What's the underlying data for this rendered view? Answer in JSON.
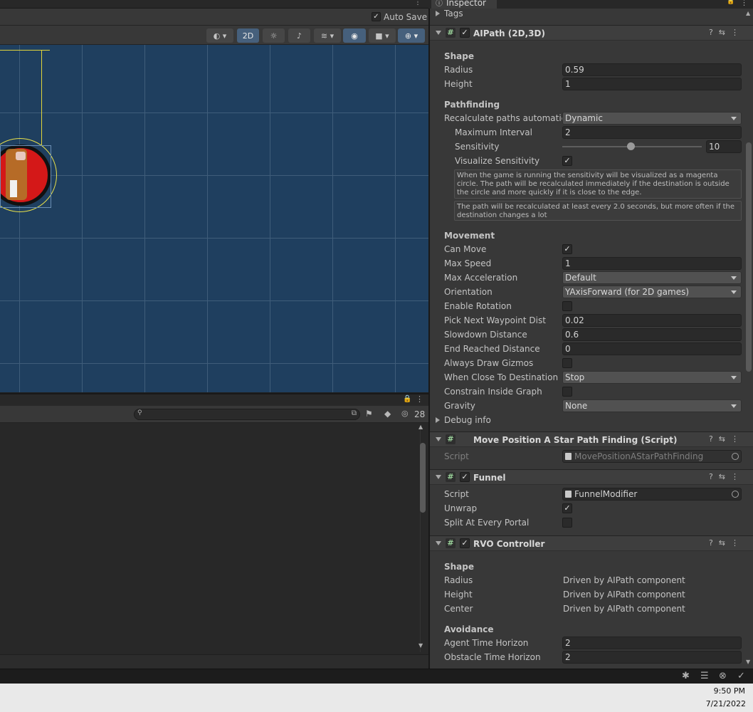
{
  "scene": {
    "auto_save": "Auto Save",
    "mode_2d": "2D"
  },
  "console": {
    "search_placeholder": "",
    "count": "28"
  },
  "inspector": {
    "tab_title": "Inspector",
    "tags_label": "Tags",
    "aipath": {
      "title": "AIPath (2D,3D)",
      "shape_section": "Shape",
      "radius_label": "Radius",
      "radius_value": "0.59",
      "height_label": "Height",
      "height_value": "1",
      "pathfinding_section": "Pathfinding",
      "recalc_label": "Recalculate paths automatica",
      "recalc_value": "Dynamic",
      "maxint_label": "Maximum Interval",
      "maxint_value": "2",
      "sens_label": "Sensitivity",
      "sens_value": "10",
      "sens_fraction": 0.49,
      "vissens_label": "Visualize Sensitivity",
      "vissens_checked": "✓",
      "help1": "When the game is running the sensitivity will be visualized as a magenta circle. The path will be recalculated immediately if the destination is outside the circle and more quickly if it is close to the edge.",
      "help2": "The path will be recalculated at least every 2.0 seconds, but more often if the destination changes a lot",
      "movement_section": "Movement",
      "canmove_label": "Can Move",
      "canmove_checked": "✓",
      "maxspeed_label": "Max Speed",
      "maxspeed_value": "1",
      "maxacc_label": "Max Acceleration",
      "maxacc_value": "Default",
      "orient_label": "Orientation",
      "orient_value": "YAxisForward (for 2D games)",
      "enrot_label": "Enable Rotation",
      "pnwd_label": "Pick Next Waypoint Dist",
      "pnwd_value": "0.02",
      "slow_label": "Slowdown Distance",
      "slow_value": "0.6",
      "endr_label": "End Reached Distance",
      "endr_value": "0",
      "adg_label": "Always Draw Gizmos",
      "wctd_label": "When Close To Destination",
      "wctd_value": "Stop",
      "cig_label": "Constrain Inside Graph",
      "grav_label": "Gravity",
      "grav_value": "None",
      "debug_label": "Debug info"
    },
    "movepos": {
      "title": "Move Position A Star Path Finding (Script)",
      "script_label": "Script",
      "script_value": "MovePositionAStarPathFinding"
    },
    "funnel": {
      "title": "Funnel",
      "script_label": "Script",
      "script_value": "FunnelModifier",
      "unwrap_label": "Unwrap",
      "unwrap_checked": "✓",
      "split_label": "Split At Every Portal"
    },
    "rvo": {
      "title": "RVO Controller",
      "shape_section": "Shape",
      "radius_label": "Radius",
      "radius_value": "Driven by AIPath component",
      "height_label": "Height",
      "height_value": "Driven by AIPath component",
      "center_label": "Center",
      "center_value": "Driven by AIPath component",
      "avoid_section": "Avoidance",
      "ath_label": "Agent Time Horizon",
      "ath_value": "2",
      "oth_label": "Obstacle Time Horizon",
      "oth_value": "2"
    }
  },
  "taskbar": {
    "time": "9:50 PM",
    "date": "7/21/2022"
  }
}
